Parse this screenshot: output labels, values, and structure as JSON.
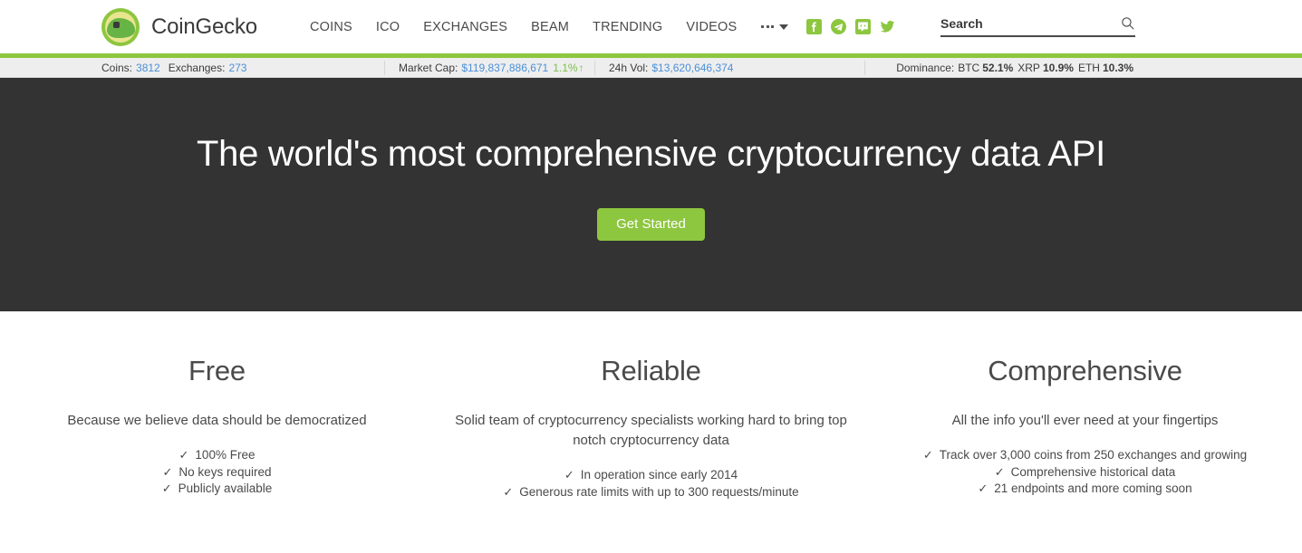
{
  "header": {
    "brand": "CoinGecko",
    "nav": [
      {
        "label": "COINS",
        "name": "nav-coins"
      },
      {
        "label": "ICO",
        "name": "nav-ico"
      },
      {
        "label": "EXCHANGES",
        "name": "nav-exchanges"
      },
      {
        "label": "BEAM",
        "name": "nav-beam"
      },
      {
        "label": "TRENDING",
        "name": "nav-trending"
      },
      {
        "label": "VIDEOS",
        "name": "nav-videos"
      }
    ],
    "socials": [
      "facebook-icon",
      "telegram-icon",
      "discord-icon",
      "twitter-icon"
    ],
    "search": {
      "placeholder": "Search",
      "value": "",
      "icon": "search-icon"
    },
    "more_menu_icon": "ellipsis-icon"
  },
  "stats": {
    "coins_label": "Coins:",
    "coins_value": "3812",
    "exchanges_label": "Exchanges:",
    "exchanges_value": "273",
    "market_cap_label": "Market Cap:",
    "market_cap_value": "$119,837,886,671",
    "market_cap_change": "1.1%",
    "market_cap_arrow": "↑",
    "vol_label": "24h Vol:",
    "vol_value": "$13,620,646,374",
    "dominance_label": "Dominance:",
    "dom_btc_label": "BTC",
    "dom_btc_value": "52.1%",
    "dom_xrp_label": "XRP",
    "dom_xrp_value": "10.9%",
    "dom_eth_label": "ETH",
    "dom_eth_value": "10.3%"
  },
  "hero": {
    "title": "The world's most comprehensive cryptocurrency data API",
    "cta": "Get Started"
  },
  "features": [
    {
      "title": "Free",
      "desc": "Because we believe data should be democratized",
      "items": [
        "100% Free",
        "No keys required",
        "Publicly available"
      ]
    },
    {
      "title": "Reliable",
      "desc": "Solid team of cryptocurrency specialists working hard to bring top notch cryptocurrency data",
      "items": [
        "In operation since early 2014",
        "Generous rate limits with up to 300 requests/minute"
      ]
    },
    {
      "title": "Comprehensive",
      "desc": "All the info you'll ever need at your fingertips",
      "items": [
        "Track over 3,000 coins from 250 exchanges and growing",
        "Comprehensive historical data",
        "21 endpoints and more coming soon"
      ]
    }
  ],
  "colors": {
    "brand_green": "#8dc63f",
    "hero_bg": "#333333",
    "stats_bg": "#eeeeee",
    "link_blue": "#4a90d9",
    "positive_green": "#7cc04b"
  },
  "check_glyph": "✓"
}
